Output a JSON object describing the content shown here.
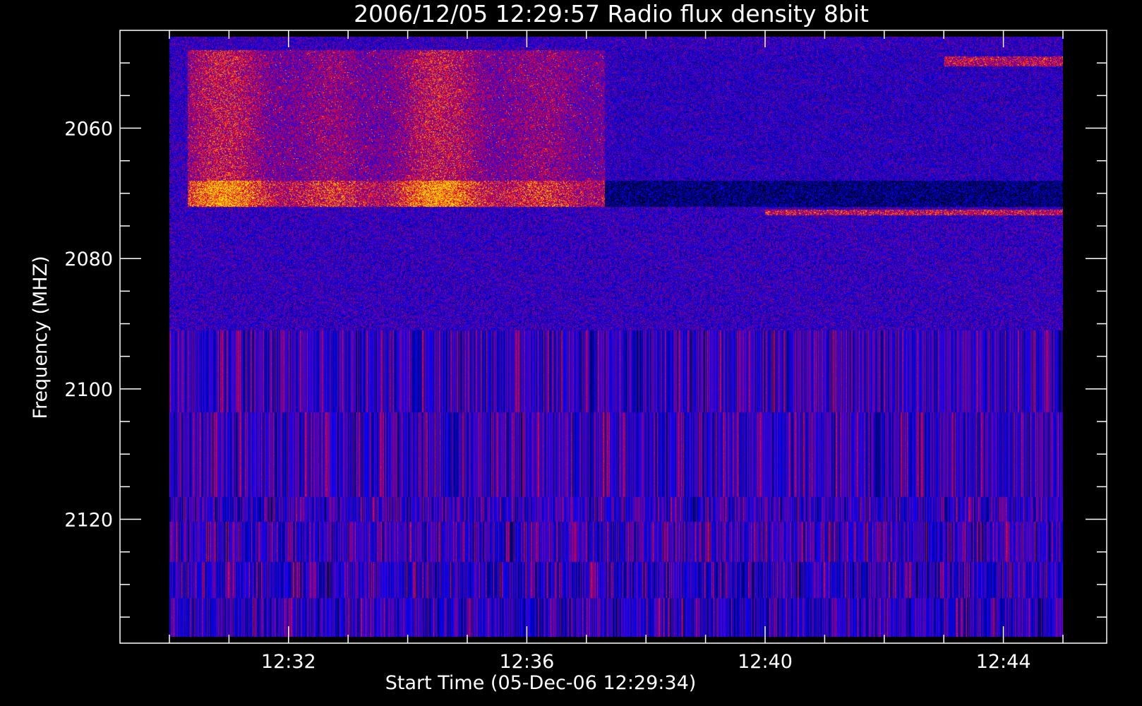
{
  "chart_data": {
    "type": "heatmap",
    "title": "2006/12/05 12:29:57 Radio flux density 8bit",
    "xlabel": "Start Time (05-Dec-06 12:29:34)",
    "ylabel": "Frequency (MHZ)",
    "x_range": [
      "12:29:34",
      "12:45:00"
    ],
    "y_range_mhz": [
      2045,
      2139
    ],
    "y_inverted": true,
    "x_ticks": [
      {
        "label": "12:32",
        "minutes": 32
      },
      {
        "label": "12:36",
        "minutes": 36
      },
      {
        "label": "12:40",
        "minutes": 40
      },
      {
        "label": "12:44",
        "minutes": 44
      }
    ],
    "y_ticks": [
      {
        "label": "2060",
        "mhz": 2060
      },
      {
        "label": "2080",
        "mhz": 2080
      },
      {
        "label": "2100",
        "mhz": 2100
      },
      {
        "label": "2120",
        "mhz": 2120
      }
    ],
    "data_time_range_minutes": [
      30.0,
      45.0
    ],
    "data_freq_range_mhz": [
      2046,
      2138
    ],
    "colormap": {
      "low": "#000000",
      "mid": "#0000ff",
      "high": "#ff0000",
      "peak": "#ffff00"
    },
    "features": [
      {
        "kind": "emission-band",
        "freq_mhz": [
          2048,
          2072
        ],
        "time_minutes": [
          30.3,
          37.3
        ],
        "intensity": "high"
      },
      {
        "kind": "dark-absorption-band",
        "freq_mhz": [
          2068,
          2072
        ],
        "time_minutes": [
          37.3,
          45.0
        ],
        "intensity": "low"
      },
      {
        "kind": "narrow-line",
        "freq_mhz": [
          2072.5,
          2073.3
        ],
        "time_minutes": [
          40.0,
          45.0
        ],
        "intensity": "high"
      },
      {
        "kind": "narrow-line",
        "freq_mhz": [
          2049,
          2050.5
        ],
        "time_minutes": [
          43.0,
          45.0
        ],
        "intensity": "high"
      },
      {
        "kind": "striped-region",
        "freq_mhz": [
          2091,
          2138
        ],
        "time_minutes": [
          30.0,
          45.0
        ],
        "intensity": "medium"
      }
    ]
  }
}
